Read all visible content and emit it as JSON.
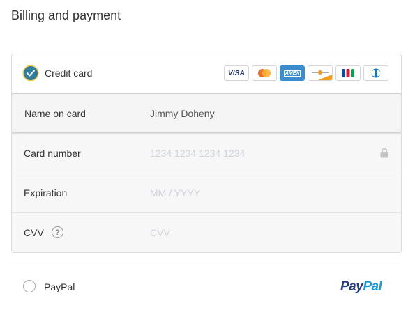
{
  "page": {
    "title": "Billing and payment"
  },
  "credit_card": {
    "label": "Credit card",
    "selected": true,
    "brands": [
      {
        "name": "Visa",
        "icon": "visa-logo-icon",
        "text": "VISA"
      },
      {
        "name": "Mastercard",
        "icon": "mastercard-logo-icon"
      },
      {
        "name": "American Express",
        "icon": "amex-logo-icon",
        "text": "AMEX"
      },
      {
        "name": "Discover",
        "icon": "discover-logo-icon"
      },
      {
        "name": "JCB",
        "icon": "jcb-logo-icon"
      },
      {
        "name": "Diners Club",
        "icon": "diners-logo-icon"
      }
    ],
    "fields": {
      "name_on_card": {
        "label": "Name on card",
        "value": "Jimmy Doheny",
        "placeholder": ""
      },
      "card_number": {
        "label": "Card number",
        "value": "",
        "placeholder": "1234 1234 1234 1234"
      },
      "expiration": {
        "label": "Expiration",
        "value": "",
        "placeholder": "MM / YYYY"
      },
      "cvv": {
        "label": "CVV",
        "value": "",
        "placeholder": "CVV",
        "help": "?"
      }
    }
  },
  "paypal": {
    "label": "PayPal",
    "selected": false,
    "logo_part1": "Pay",
    "logo_part2": "Pal"
  },
  "colors": {
    "check_fill": "#2f7ea0",
    "check_ring": "#f5c544",
    "paypal_dark": "#253b80",
    "paypal_light": "#179bd7",
    "amex": "#3a8ccf"
  }
}
